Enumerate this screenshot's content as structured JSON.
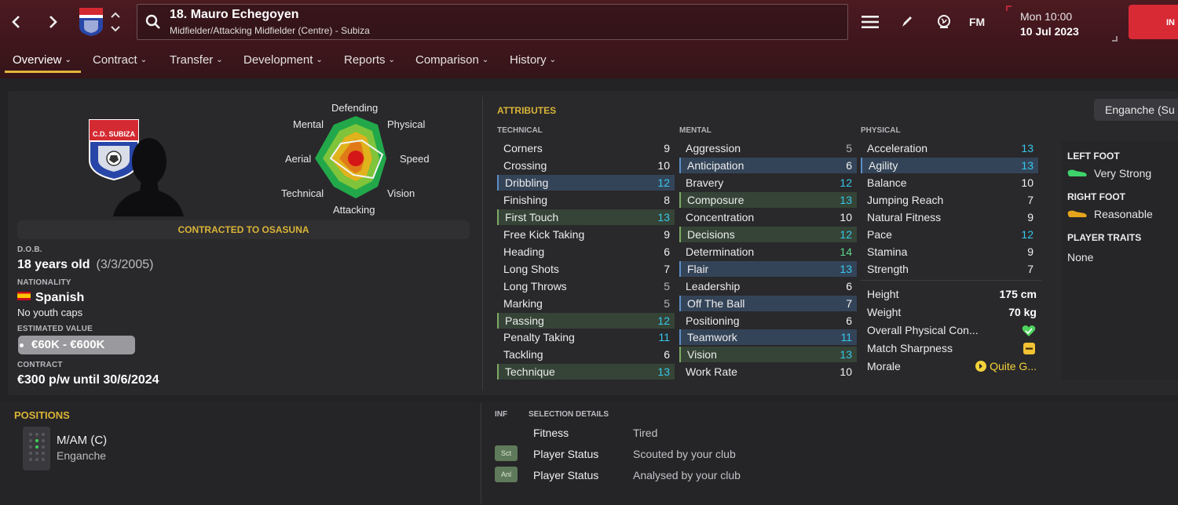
{
  "header": {
    "back_icon": "chevron-left-icon",
    "forward_icon": "chevron-right-icon",
    "player_name": "18. Mauro Echegoyen",
    "player_position_club": "Midfielder/Attacking Midfielder (Centre) - Subiza",
    "day_time": "Mon 10:00",
    "date": "10 Jul 2023",
    "continue_label": "IN",
    "icons": [
      "menu-icon",
      "pencil-icon",
      "globe-icon",
      "fm-logo-icon"
    ],
    "fm_label": "FM",
    "accent_color": "#d72a35"
  },
  "tabs": [
    {
      "label": "Overview"
    },
    {
      "label": "Contract"
    },
    {
      "label": "Transfer"
    },
    {
      "label": "Development"
    },
    {
      "label": "Reports"
    },
    {
      "label": "Comparison"
    },
    {
      "label": "History"
    }
  ],
  "profile": {
    "crest_text": "C.D. SUBIZA",
    "radar_labels": {
      "defending": "Defending",
      "physical": "Physical",
      "speed": "Speed",
      "vision": "Vision",
      "attacking": "Attacking",
      "technical": "Technical",
      "aerial": "Aerial",
      "mental": "Mental"
    },
    "contracted_to": "CONTRACTED TO OSASUNA",
    "dob_label": "D.O.B.",
    "age": "18 years old",
    "dob": "(3/3/2005)",
    "nationality_label": "NATIONALITY",
    "nationality": "Spanish",
    "youth_caps": "No youth caps",
    "estimated_value_label": "ESTIMATED VALUE",
    "estimated_value": "€60K - €600K",
    "contract_label": "CONTRACT",
    "contract": "€300 p/w until 30/6/2024"
  },
  "attributes": {
    "title": "ATTRIBUTES",
    "technical_head": "TECHNICAL",
    "mental_head": "MENTAL",
    "physical_head": "PHYSICAL",
    "technical": [
      {
        "name": "Corners",
        "value": "9",
        "hl": ""
      },
      {
        "name": "Crossing",
        "value": "10",
        "hl": ""
      },
      {
        "name": "Dribbling",
        "value": "12",
        "hl": "blue"
      },
      {
        "name": "Finishing",
        "value": "8",
        "hl": ""
      },
      {
        "name": "First Touch",
        "value": "13",
        "hl": "green"
      },
      {
        "name": "Free Kick Taking",
        "value": "9",
        "hl": ""
      },
      {
        "name": "Heading",
        "value": "6",
        "hl": ""
      },
      {
        "name": "Long Shots",
        "value": "7",
        "hl": ""
      },
      {
        "name": "Long Throws",
        "value": "5",
        "hl": ""
      },
      {
        "name": "Marking",
        "value": "5",
        "hl": ""
      },
      {
        "name": "Passing",
        "value": "12",
        "hl": "green"
      },
      {
        "name": "Penalty Taking",
        "value": "11",
        "hl": ""
      },
      {
        "name": "Tackling",
        "value": "6",
        "hl": ""
      },
      {
        "name": "Technique",
        "value": "13",
        "hl": "green"
      }
    ],
    "mental": [
      {
        "name": "Aggression",
        "value": "5",
        "hl": ""
      },
      {
        "name": "Anticipation",
        "value": "6",
        "hl": "blue"
      },
      {
        "name": "Bravery",
        "value": "12",
        "hl": ""
      },
      {
        "name": "Composure",
        "value": "13",
        "hl": "green"
      },
      {
        "name": "Concentration",
        "value": "10",
        "hl": ""
      },
      {
        "name": "Decisions",
        "value": "12",
        "hl": "green"
      },
      {
        "name": "Determination",
        "value": "14",
        "hl": ""
      },
      {
        "name": "Flair",
        "value": "13",
        "hl": "blue"
      },
      {
        "name": "Leadership",
        "value": "6",
        "hl": ""
      },
      {
        "name": "Off The Ball",
        "value": "7",
        "hl": "blue"
      },
      {
        "name": "Positioning",
        "value": "6",
        "hl": ""
      },
      {
        "name": "Teamwork",
        "value": "11",
        "hl": "blue"
      },
      {
        "name": "Vision",
        "value": "13",
        "hl": "green"
      },
      {
        "name": "Work Rate",
        "value": "10",
        "hl": ""
      }
    ],
    "physical": [
      {
        "name": "Acceleration",
        "value": "13",
        "hl": ""
      },
      {
        "name": "Agility",
        "value": "13",
        "hl": "blue"
      },
      {
        "name": "Balance",
        "value": "10",
        "hl": ""
      },
      {
        "name": "Jumping Reach",
        "value": "7",
        "hl": ""
      },
      {
        "name": "Natural Fitness",
        "value": "9",
        "hl": ""
      },
      {
        "name": "Pace",
        "value": "12",
        "hl": ""
      },
      {
        "name": "Stamina",
        "value": "9",
        "hl": ""
      },
      {
        "name": "Strength",
        "value": "7",
        "hl": ""
      }
    ],
    "physical_info": {
      "height_label": "Height",
      "height": "175 cm",
      "weight_label": "Weight",
      "weight": "70 kg",
      "condition_label": "Overall Physical Con...",
      "condition_icon": "heart-icon",
      "sharpness_label": "Match Sharpness",
      "sharpness_icon": "sharpness-icon",
      "morale_label": "Morale",
      "morale_value": "Quite G...",
      "morale_icon": "morale-arrow-icon"
    }
  },
  "sidebar": {
    "role": "Enganche (Su",
    "left_foot_label": "LEFT FOOT",
    "left_foot": "Very Strong",
    "right_foot_label": "RIGHT FOOT",
    "right_foot": "Reasonable",
    "traits_label": "PLAYER TRAITS",
    "traits": "None"
  },
  "positions": {
    "title": "POSITIONS",
    "position": "M/AM (C)",
    "role": "Enganche"
  },
  "selection": {
    "inf_label": "INF",
    "title": "SELECTION DETAILS",
    "rows": [
      {
        "badge": "",
        "name": "Fitness",
        "value": "Tired"
      },
      {
        "badge": "Sct",
        "name": "Player Status",
        "value": "Scouted by your club"
      },
      {
        "badge": "Anl",
        "name": "Player Status",
        "value": "Analysed by your club"
      }
    ]
  },
  "colors": {
    "gold": "#d8b437",
    "cyan_value": "#36c8ec",
    "green_value": "#5fd98a"
  }
}
